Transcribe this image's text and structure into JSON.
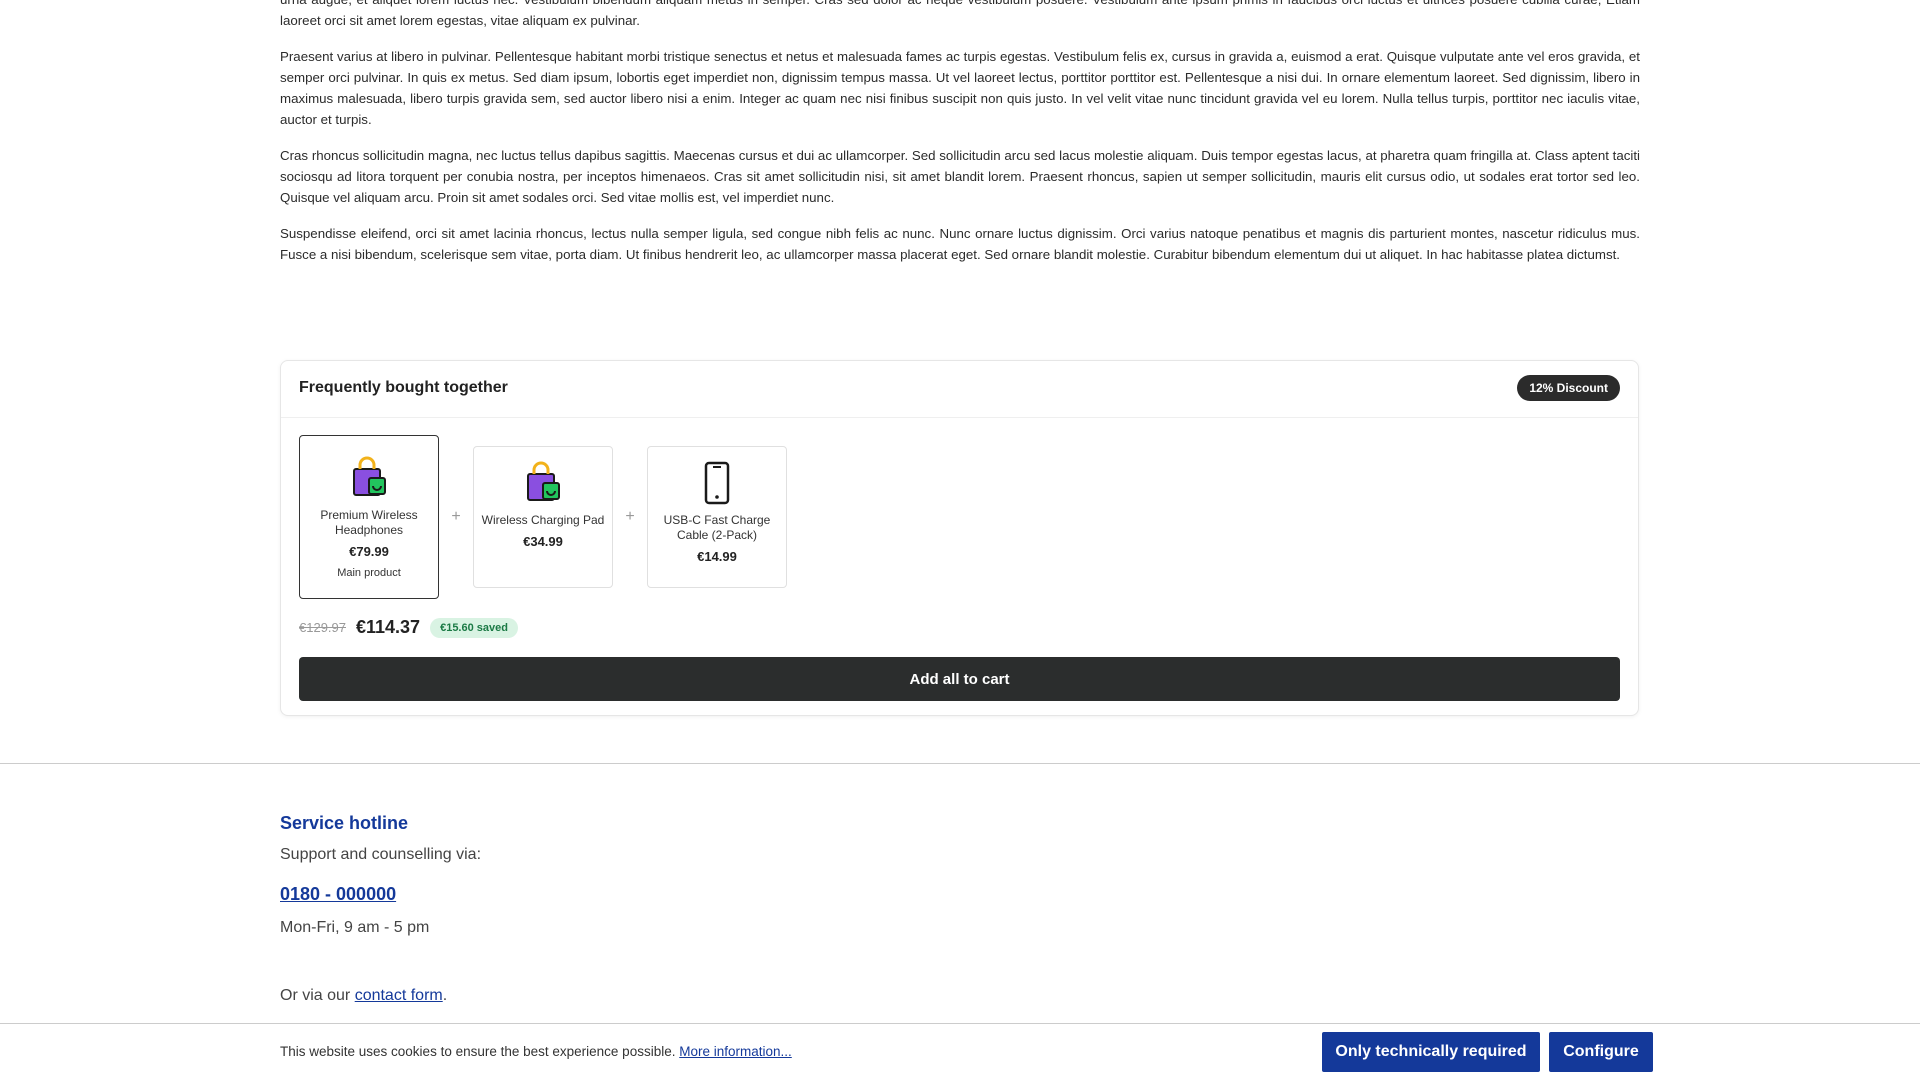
{
  "article": {
    "paragraphs": [
      "urna augue, et aliquet lorem luctus nec. Vestibulum bibendum aliquam metus in semper. Cras sed dolor ac neque vestibulum posuere. Vestibulum ante ipsum primis in faucibus orci luctus et ultrices posuere cubilia curae; Etiam laoreet orci sit amet lorem egestas, vitae aliquam ex pulvinar.",
      "Praesent varius at libero in pulvinar. Pellentesque habitant morbi tristique senectus et netus et malesuada fames ac turpis egestas. Vestibulum felis ex, cursus in gravida a, euismod a erat. Quisque vulputate ante vel eros gravida, et semper orci pulvinar. In quis ex metus. Sed diam ipsum, lobortis eget imperdiet non, dignissim tempus massa. Ut vel laoreet lectus, porttitor porttitor est. Pellentesque a nisi dui. In ornare elementum laoreet. Sed dignissim, libero in maximus malesuada, libero turpis gravida sem, sed auctor libero nisi a enim. Integer ac quam nec nisi finibus suscipit non quis justo. In vel velit vitae nunc tincidunt gravida vel eu lorem. Nulla tellus turpis, porttitor nec iaculis vitae, auctor et turpis.",
      "Cras rhoncus sollicitudin magna, nec luctus tellus dapibus sagittis. Maecenas cursus et dui ac ullamcorper. Sed sollicitudin arcu sed lacus molestie aliquam. Duis tempor egestas lacus, at pharetra quam fringilla at. Class aptent taciti sociosqu ad litora torquent per conubia nostra, per inceptos himenaeos. Cras sit amet sollicitudin nisi, sit amet blandit lorem. Praesent rhoncus, sapien ut semper sollicitudin, mauris elit cursus odio, ut sodales erat tortor sed leo. Quisque vel aliquam arcu. Proin sit amet sodales orci. Sed vitae mollis est, vel imperdiet nunc.",
      "Suspendisse eleifend, orci sit amet lacinia rhoncus, lectus nulla semper ligula, sed congue nibh felis ac nunc. Nunc ornare luctus dignissim. Orci varius natoque penatibus et magnis dis parturient montes, nascetur ridiculus mus. Fusce a nisi bibendum, scelerisque sem vitae, porta diam. Ut finibus hendrerit leo, ac ullamcorper massa placerat eget. Sed ornare blandit molestie. Curabitur bibendum elementum dui ut aliquet. In hac habitasse platea dictumst."
    ]
  },
  "bundle": {
    "title": "Frequently bought together",
    "badge": "12% Discount",
    "plus": "+",
    "items": [
      {
        "name": "Premium Wireless Headphones",
        "price": "€79.99",
        "note": "Main product",
        "icon": "shopping-bag-icon"
      },
      {
        "name": "Wireless Charging Pad",
        "price": "€34.99",
        "icon": "shopping-bag-icon"
      },
      {
        "name": "USB-C Fast Charge Cable (2-Pack)",
        "price": "€14.99",
        "icon": "smartphone-icon"
      }
    ],
    "price_old": "€129.97",
    "price_new": "€114.37",
    "saved": "€15.60 saved",
    "add_button": "Add all to cart"
  },
  "service": {
    "title": "Service hotline",
    "subtitle": "Support and counselling via:",
    "phone": "0180 - 000000",
    "hours": "Mon-Fri, 9 am - 5 pm",
    "contact_prefix": "Or via our ",
    "contact_link": "contact form",
    "contact_suffix": "."
  },
  "cookie": {
    "text": "This website uses cookies to ensure the best experience possible. ",
    "more_link": "More information...",
    "required_button": "Only technically required",
    "configure_button": "Configure"
  },
  "colors": {
    "brand_blue": "#14399a",
    "button_dark": "#2b2d2d",
    "saved_green": "#1b7a45",
    "bag_purple": "#8a4fe0",
    "bag_yellow": "#f2b21a",
    "bag_green": "#22c55e"
  }
}
